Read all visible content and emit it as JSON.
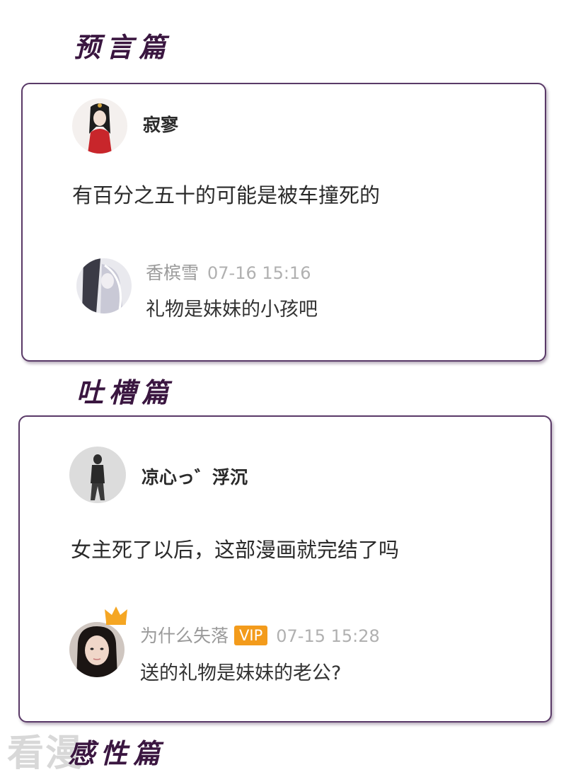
{
  "sections": {
    "prediction_title": "预言篇",
    "roast_title": "吐槽篇",
    "emotional_title": "感性篇"
  },
  "card1": {
    "username": "寂寥",
    "comment": "有百分之五十的可能是被车撞死的",
    "reply": {
      "username": "香槟雪",
      "time": "07-16 15:16",
      "text": "礼物是妹妹的小孩吧"
    }
  },
  "card2": {
    "username": "凉心っ゛浮沉",
    "comment": "女主死了以后，这部漫画就完结了吗",
    "reply": {
      "username": "为什么失落",
      "badge": "VIP",
      "time": "07-15 15:28",
      "text": "送的礼物是妹妹的老公?"
    }
  },
  "watermark": "看漫",
  "colors": {
    "accent": "#5a3a68",
    "vip": "#f39b1b",
    "title": "#3a1640"
  },
  "icons": {
    "crown": "crown-icon"
  }
}
